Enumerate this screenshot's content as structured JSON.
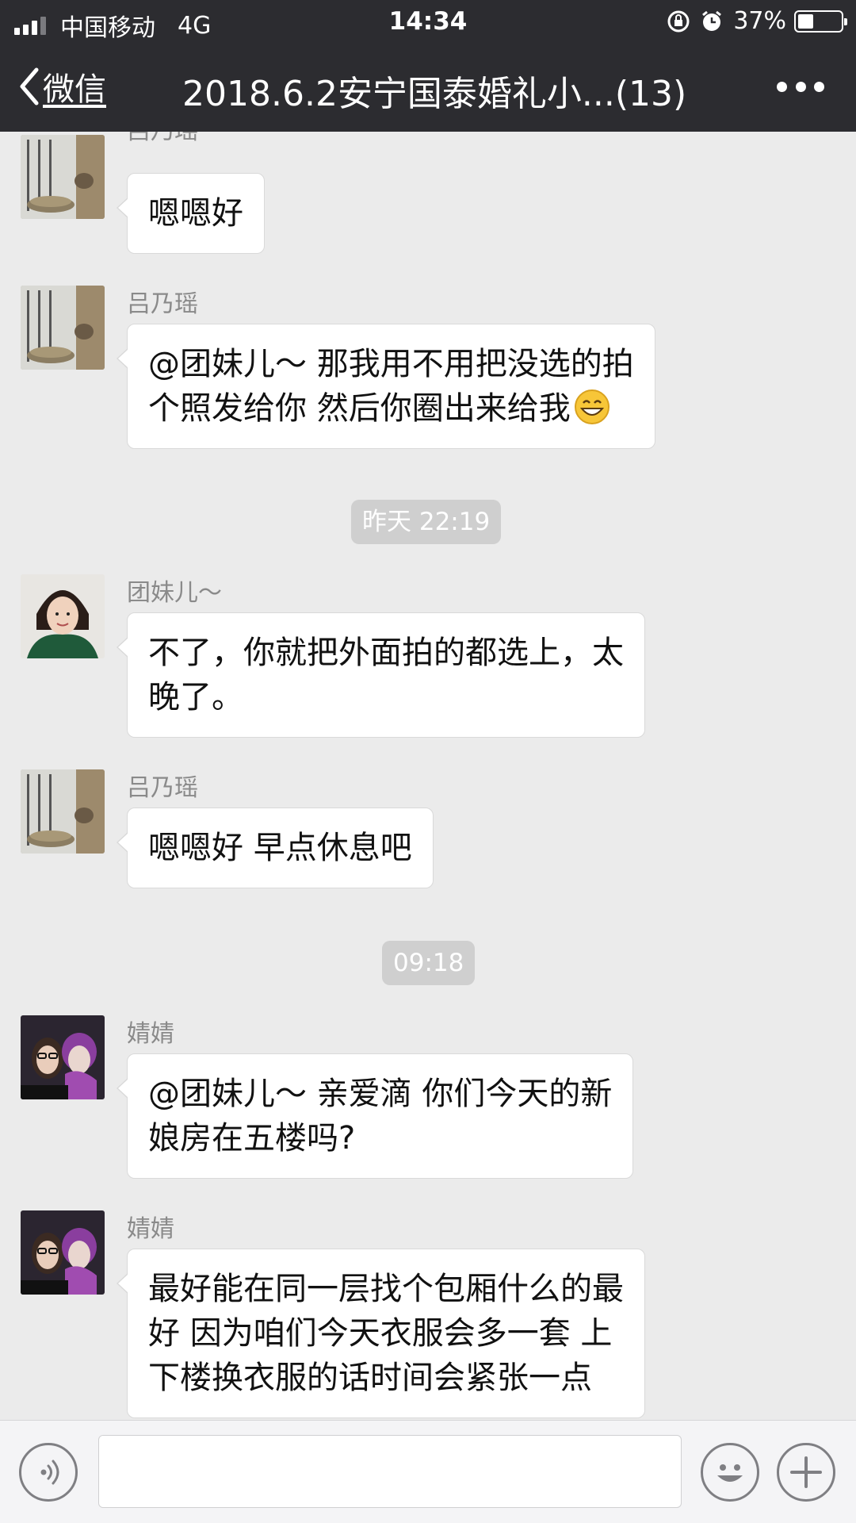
{
  "status_bar": {
    "carrier": "中国移动",
    "network": "4G",
    "time": "14:34",
    "battery": "37%",
    "battery_level": 0.37
  },
  "nav": {
    "back_label": "微信",
    "title": "2018.6.2安宁国泰婚礼小...(13)"
  },
  "messages": [
    {
      "sender": "吕乃瑶",
      "lines": [
        "嗯嗯好"
      ]
    },
    {
      "sender": "吕乃瑶",
      "lines": [
        "@团妹儿～ 那我用不用把没选的拍",
        "个照发给你 然后你圈出来给我"
      ],
      "emoji": "grinning-face-emoji"
    },
    {
      "sender": "团妹儿～",
      "lines": [
        "不了，你就把外面拍的都选上，太",
        "晚了。"
      ]
    },
    {
      "sender": "吕乃瑶",
      "lines": [
        "嗯嗯好 早点休息吧"
      ]
    },
    {
      "sender": "婧婧",
      "lines": [
        "@团妹儿～  亲爱滴 你们今天的新",
        "娘房在五楼吗?"
      ]
    },
    {
      "sender": "婧婧",
      "lines": [
        "最好能在同一层找个包厢什么的最",
        "好 因为咱们今天衣服会多一套 上",
        "下楼换衣服的话时间会紧张一点"
      ]
    }
  ],
  "timestamps": [
    "昨天 22:19",
    "09:18"
  ],
  "input_bar": {
    "voice_icon": "voice-icon",
    "emoji_icon": "emoji-icon",
    "plus_icon": "plus-icon",
    "text_value": ""
  },
  "colors": {
    "nav_bg": "#2c2c30",
    "chat_bg": "#ebebeb",
    "bubble_bg": "#ffffff",
    "timestamp_bg": "#cfcfcf"
  }
}
